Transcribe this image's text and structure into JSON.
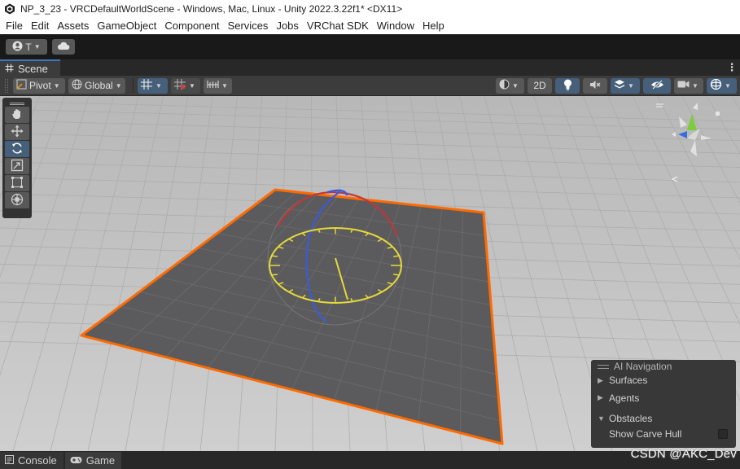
{
  "window": {
    "title": "NP_3_23 - VRCDefaultWorldScene - Windows, Mac, Linux - Unity 2022.3.22f1* <DX11>"
  },
  "menu": [
    "File",
    "Edit",
    "Assets",
    "GameObject",
    "Component",
    "Services",
    "Jobs",
    "VRChat SDK",
    "Window",
    "Help"
  ],
  "toolbar": {
    "account_initial": "T"
  },
  "tabs": {
    "scene": "Scene"
  },
  "scene_toolbar": {
    "pivot": "Pivot",
    "global": "Global",
    "mode_2d": "2D"
  },
  "ai_navigation": {
    "title": "AI Navigation",
    "items": [
      "Surfaces",
      "Agents",
      "Obstacles"
    ],
    "option": "Show Carve Hull"
  },
  "bottom_tabs": {
    "console": "Console",
    "game": "Game"
  },
  "watermark": "CSDN @AKC_Dev",
  "colors": {
    "selection_outline": "#ff6a00",
    "active_button": "#46607c",
    "ground": "#c4c4c4",
    "plane": "#5b5b5d"
  }
}
